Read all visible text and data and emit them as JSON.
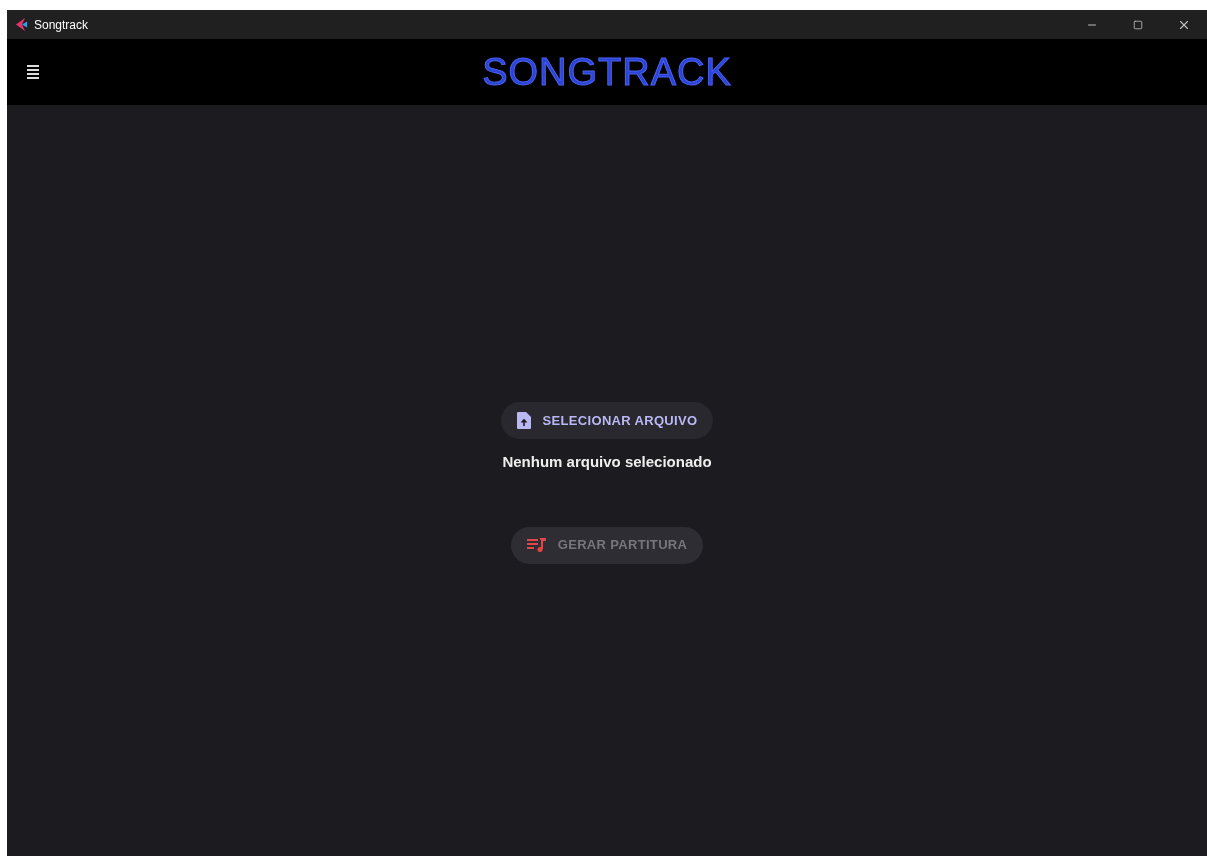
{
  "window": {
    "title": "Songtrack"
  },
  "header": {
    "logo": "SONGTRACK"
  },
  "file_button": {
    "label": "SELECIONAR ARQUIVO",
    "disabled": false
  },
  "file_status": "Nenhum arquivo selecionado",
  "generate_button": {
    "label": "GERAR PARTITURA",
    "disabled": true
  }
}
